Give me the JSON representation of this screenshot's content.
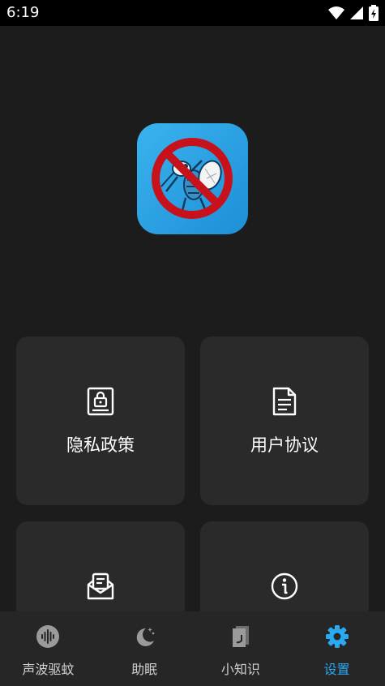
{
  "status_bar": {
    "time": "6:19"
  },
  "cards": [
    {
      "label": "隐私政策",
      "icon": "privacy-document-icon"
    },
    {
      "label": "用户协议",
      "icon": "document-icon"
    },
    {
      "label": "",
      "icon": "mail-open-icon"
    },
    {
      "label": "",
      "icon": "info-icon"
    }
  ],
  "nav": {
    "items": [
      {
        "label": "声波驱蚊",
        "icon": "soundwave-icon"
      },
      {
        "label": "助眠",
        "icon": "moon-stars-icon"
      },
      {
        "label": "小知识",
        "icon": "book-icon"
      },
      {
        "label": "设置",
        "icon": "gear-icon"
      }
    ],
    "active_index": 3
  },
  "colors": {
    "accent": "#2aa8f0",
    "background": "#1c1c1c",
    "card": "#2a2a2a",
    "nav_background": "#262626",
    "logo": "#2fa6e8"
  }
}
